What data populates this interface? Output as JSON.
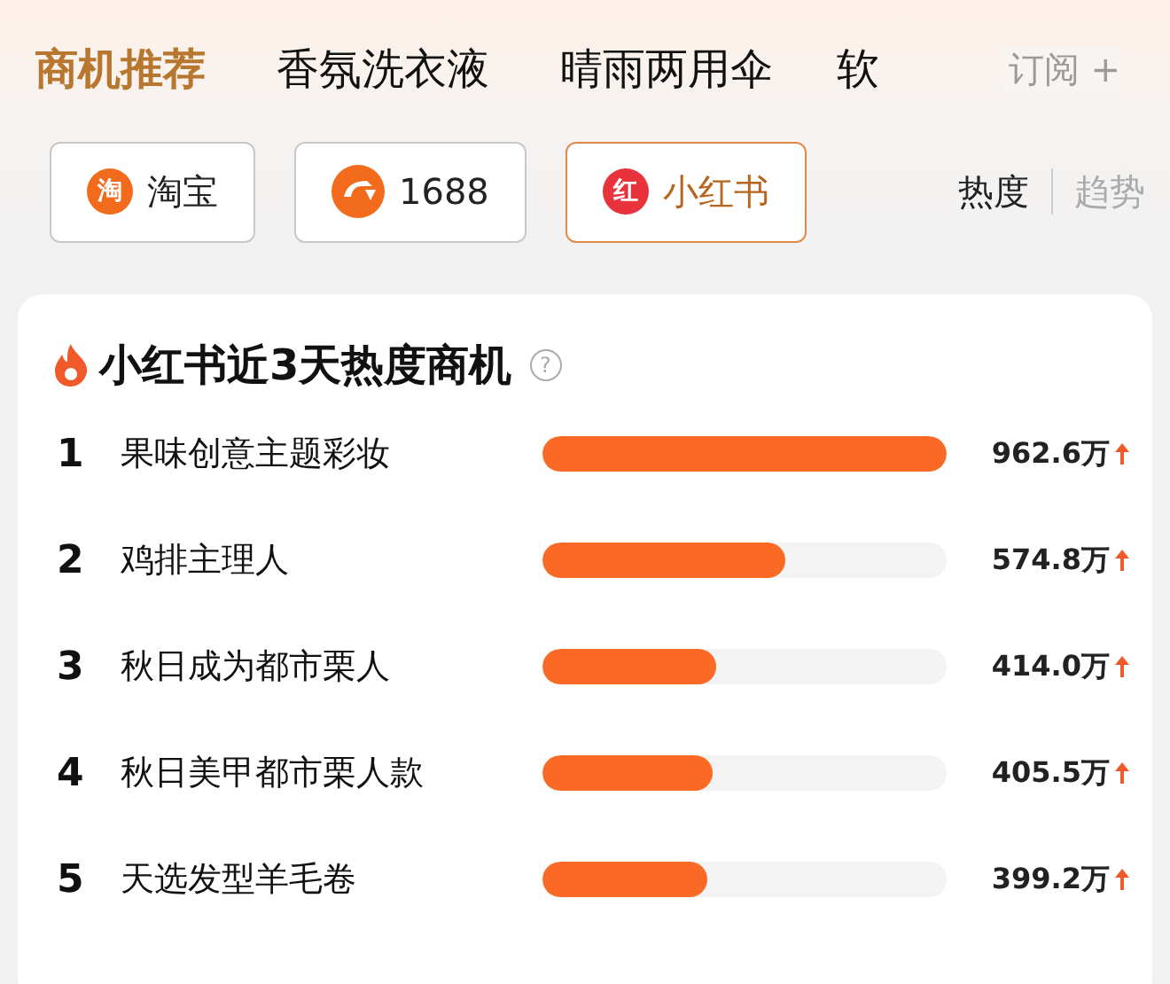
{
  "tabs": [
    {
      "label": "商机推荐",
      "selected": true
    },
    {
      "label": "香氛洗衣液",
      "selected": false
    },
    {
      "label": "晴雨两用伞",
      "selected": false
    },
    {
      "label": "软",
      "selected": false
    }
  ],
  "subscribe": {
    "label": "订阅",
    "icon": "+"
  },
  "platforms": [
    {
      "label": "淘宝",
      "badge": "淘",
      "kind": "taobao",
      "selected": false
    },
    {
      "label": "1688",
      "kind": "alibaba",
      "selected": false
    },
    {
      "label": "小红书",
      "badge": "红",
      "kind": "xiaohongshu",
      "selected": true
    }
  ],
  "modes": [
    {
      "label": "热度",
      "selected": true
    },
    {
      "label": "趋势",
      "selected": false
    }
  ],
  "card": {
    "title": "小红书近3天热度商机",
    "help": "?",
    "rows": [
      {
        "rank": "1",
        "name": "果味创意主题彩妆",
        "level": 1.0,
        "value": "962.6万",
        "rising": true
      },
      {
        "rank": "2",
        "name": "鸡排主理人",
        "level": 0.6,
        "value": "574.8万",
        "rising": true
      },
      {
        "rank": "3",
        "name": "秋日成为都市栗人",
        "level": 0.43,
        "value": "414.0万",
        "rising": true
      },
      {
        "rank": "4",
        "name": "秋日美甲都市栗人款",
        "level": 0.42,
        "value": "405.5万",
        "rising": true
      },
      {
        "rank": "5",
        "name": "天选发型羊毛卷",
        "level": 0.41,
        "value": "399.2万",
        "rising": true
      }
    ]
  }
}
